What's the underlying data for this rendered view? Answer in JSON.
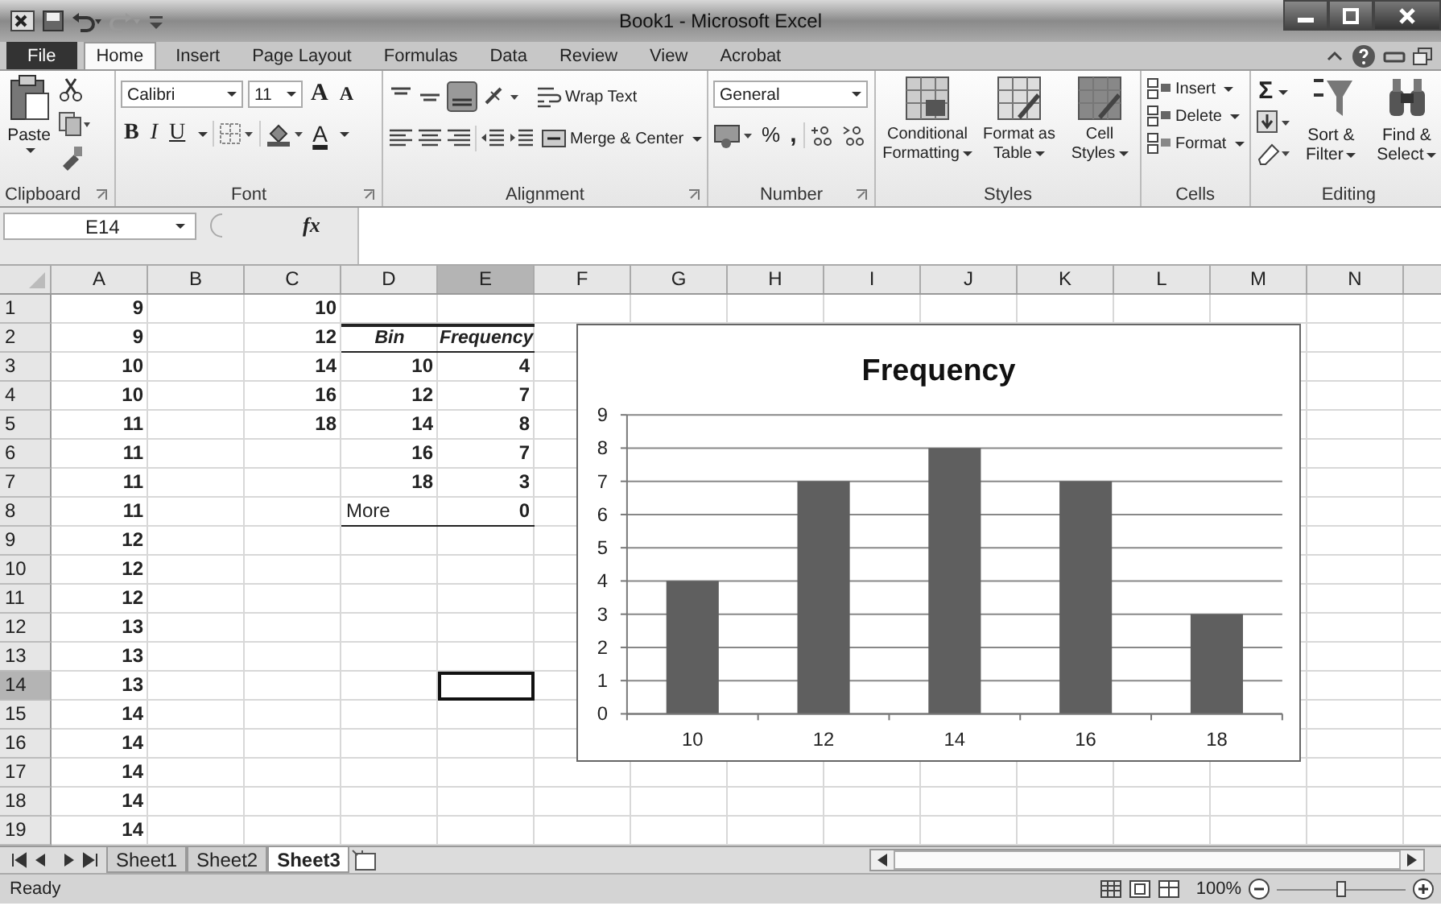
{
  "window": {
    "title": "Book1 - Microsoft Excel"
  },
  "ribbon_tabs": [
    {
      "label": "File",
      "selected": false,
      "kind": "file"
    },
    {
      "label": "Home",
      "selected": true,
      "kind": "tab"
    },
    {
      "label": "Insert",
      "selected": false,
      "kind": "tab"
    },
    {
      "label": "Page Layout",
      "selected": false,
      "kind": "tab"
    },
    {
      "label": "Formulas",
      "selected": false,
      "kind": "tab"
    },
    {
      "label": "Data",
      "selected": false,
      "kind": "tab"
    },
    {
      "label": "Review",
      "selected": false,
      "kind": "tab"
    },
    {
      "label": "View",
      "selected": false,
      "kind": "tab"
    },
    {
      "label": "Acrobat",
      "selected": false,
      "kind": "tab"
    }
  ],
  "ribbon": {
    "clipboard": {
      "paste": "Paste",
      "group_label": "Clipboard"
    },
    "font": {
      "font_name": "Calibri",
      "font_size": "11",
      "grow": "A",
      "shrink": "A",
      "bold": "B",
      "italic": "I",
      "underline": "U",
      "font_color": "A",
      "group_label": "Font"
    },
    "alignment": {
      "wrap_text": "Wrap Text",
      "merge_center": "Merge & Center",
      "group_label": "Alignment"
    },
    "number": {
      "format": "General",
      "percent": "%",
      "comma": ",",
      "group_label": "Number"
    },
    "styles": {
      "buttons": [
        "Conditional Formatting",
        "Format as Table",
        "Cell Styles"
      ],
      "group_label": "Styles"
    },
    "cells": {
      "buttons": [
        "Insert",
        "Delete",
        "Format"
      ],
      "group_label": "Cells"
    },
    "editing": {
      "sum": "Σ",
      "buttons": [
        "Sort & Filter",
        "Find & Select"
      ],
      "group_label": "Editing"
    }
  },
  "name_box": "E14",
  "function_label": "fx",
  "columns": [
    {
      "label": "A",
      "selected": false
    },
    {
      "label": "B",
      "selected": false
    },
    {
      "label": "C",
      "selected": false
    },
    {
      "label": "D",
      "selected": false
    },
    {
      "label": "E",
      "selected": true
    },
    {
      "label": "F",
      "selected": false
    },
    {
      "label": "G",
      "selected": false
    },
    {
      "label": "H",
      "selected": false
    },
    {
      "label": "I",
      "selected": false
    },
    {
      "label": "J",
      "selected": false
    },
    {
      "label": "K",
      "selected": false
    },
    {
      "label": "L",
      "selected": false
    },
    {
      "label": "M",
      "selected": false
    },
    {
      "label": "N",
      "selected": false
    }
  ],
  "rows": [
    {
      "label": "1",
      "selected": false,
      "kind": "plain",
      "a": "9",
      "c": "10"
    },
    {
      "label": "2",
      "selected": false,
      "kind": "table_header",
      "a": "9",
      "c": "12",
      "d": "Bin",
      "e": "Frequency"
    },
    {
      "label": "3",
      "selected": false,
      "kind": "plain",
      "a": "10",
      "c": "14",
      "d": "10",
      "e": "4"
    },
    {
      "label": "4",
      "selected": false,
      "kind": "plain",
      "a": "10",
      "c": "16",
      "d": "12",
      "e": "7"
    },
    {
      "label": "5",
      "selected": false,
      "kind": "plain",
      "a": "11",
      "c": "18",
      "d": "14",
      "e": "8"
    },
    {
      "label": "6",
      "selected": false,
      "kind": "plain",
      "a": "11",
      "d": "16",
      "e": "7"
    },
    {
      "label": "7",
      "selected": false,
      "kind": "plain",
      "a": "11",
      "d": "18",
      "e": "3"
    },
    {
      "label": "8",
      "selected": false,
      "kind": "table_end",
      "a": "11",
      "d": "More",
      "e": "0"
    },
    {
      "label": "9",
      "selected": false,
      "kind": "plain",
      "a": "12"
    },
    {
      "label": "10",
      "selected": false,
      "kind": "plain",
      "a": "12"
    },
    {
      "label": "11",
      "selected": false,
      "kind": "plain",
      "a": "12"
    },
    {
      "label": "12",
      "selected": false,
      "kind": "plain",
      "a": "13"
    },
    {
      "label": "13",
      "selected": false,
      "kind": "plain",
      "a": "13"
    },
    {
      "label": "14",
      "selected": true,
      "kind": "plain",
      "a": "13"
    },
    {
      "label": "15",
      "selected": false,
      "kind": "plain",
      "a": "14"
    },
    {
      "label": "16",
      "selected": false,
      "kind": "plain",
      "a": "14"
    },
    {
      "label": "17",
      "selected": false,
      "kind": "plain",
      "a": "14"
    },
    {
      "label": "18",
      "selected": false,
      "kind": "plain",
      "a": "14"
    },
    {
      "label": "19",
      "selected": false,
      "kind": "plain",
      "a": "14"
    }
  ],
  "chart": {
    "chart_data": {
      "type": "bar",
      "title": "Frequency",
      "categories": [
        "10",
        "12",
        "14",
        "16",
        "18"
      ],
      "series": [
        {
          "color": "#5f5f5f",
          "values": [
            4,
            7,
            8,
            7,
            3
          ]
        }
      ],
      "ylim": [
        0,
        9
      ],
      "yticks": [
        0,
        1,
        2,
        3,
        4,
        5,
        6,
        7,
        8,
        9
      ],
      "grid": true
    }
  },
  "sheet_tabs": [
    {
      "label": "Sheet1",
      "selected": false
    },
    {
      "label": "Sheet2",
      "selected": false
    },
    {
      "label": "Sheet3",
      "selected": true
    }
  ],
  "status_bar": {
    "status": "Ready",
    "zoom": "100%",
    "zoom_slider": {
      "level": 0.5
    }
  }
}
